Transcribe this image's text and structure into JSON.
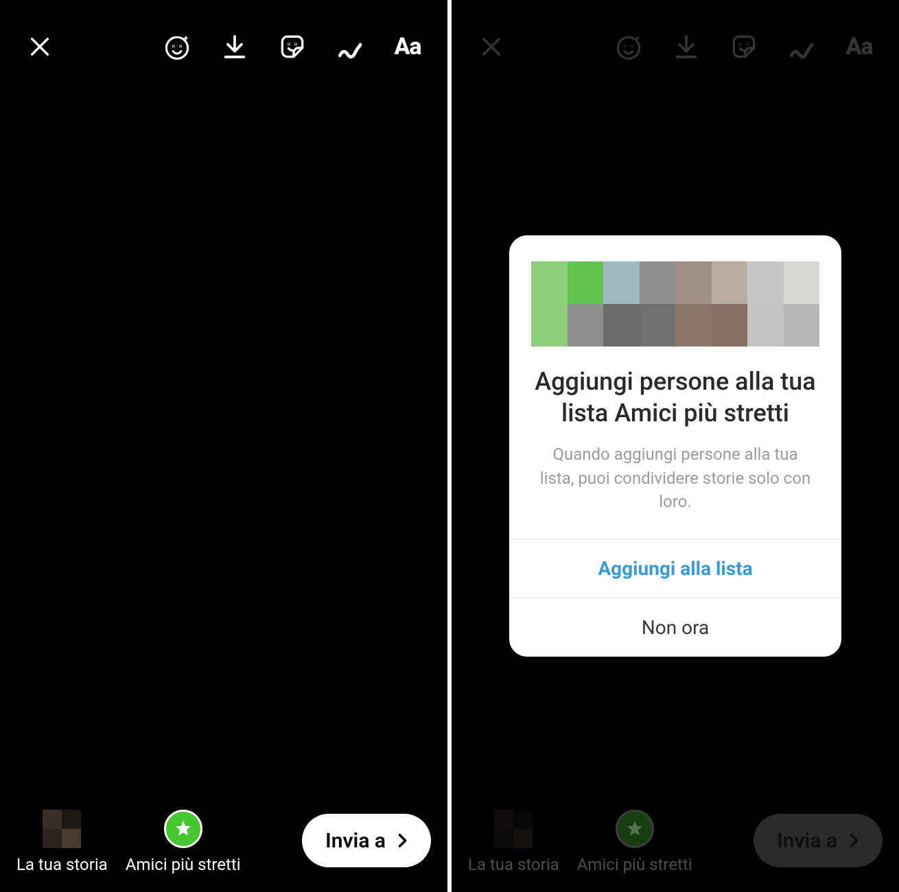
{
  "toolbar": {
    "text_tool_label": "Aa"
  },
  "bottom": {
    "your_story_label": "La tua storia",
    "close_friends_label": "Amici più stretti",
    "send_label": "Invia a"
  },
  "modal": {
    "title": "Aggiungi persone alla tua lista Amici più stretti",
    "description": "Quando aggiungi persone alla tua lista, puoi condividere storie solo con loro.",
    "primary_action": "Aggiungi alla lista",
    "secondary_action": "Non ora",
    "pixel_colors": {
      "top": [
        "#8ed07a",
        "#63c34f",
        "#a0b7bf",
        "#8f918e",
        "#9f9187",
        "#b9aca3",
        "#c8c6c4",
        "#d9d7d4"
      ],
      "bottom": [
        "#8ed07a",
        "#8f8f8f",
        "#6b6b6b",
        "#707070",
        "#8a7567",
        "#887065",
        "#c6c4c2",
        "#bab8b6"
      ]
    }
  }
}
